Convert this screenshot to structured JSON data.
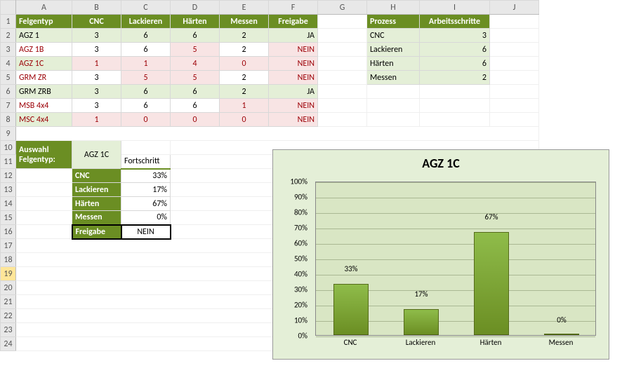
{
  "columns": [
    "A",
    "B",
    "C",
    "D",
    "E",
    "F",
    "G",
    "H",
    "I",
    "J"
  ],
  "tbl1_headers": [
    "Felgentyp",
    "CNC",
    "Lackieren",
    "Härten",
    "Messen",
    "Freigabe"
  ],
  "tbl1_rows": [
    {
      "name": "AGZ 1",
      "vals": [
        "3",
        "6",
        "6",
        "2",
        "JA"
      ],
      "style": "alt"
    },
    {
      "name": "AGZ 1B",
      "vals": [
        "3",
        "6",
        "5",
        "2",
        "NEIN"
      ],
      "style": "red",
      "redcols": [
        2
      ]
    },
    {
      "name": "AGZ 1C",
      "vals": [
        "1",
        "1",
        "4",
        "0",
        "NEIN"
      ],
      "style": "red",
      "redcols": [
        0,
        1,
        2,
        3
      ]
    },
    {
      "name": "GRM ZR",
      "vals": [
        "3",
        "5",
        "5",
        "2",
        "NEIN"
      ],
      "style": "red",
      "redcols": [
        1,
        2
      ]
    },
    {
      "name": "GRM ZRB",
      "vals": [
        "3",
        "6",
        "6",
        "2",
        "JA"
      ],
      "style": "alt"
    },
    {
      "name": "MSB 4x4",
      "vals": [
        "3",
        "6",
        "6",
        "1",
        "NEIN"
      ],
      "style": "red",
      "redcols": [
        3
      ]
    },
    {
      "name": "MSC 4x4",
      "vals": [
        "1",
        "0",
        "0",
        "0",
        "NEIN"
      ],
      "style": "red",
      "redcols": [
        0,
        1,
        2,
        3
      ]
    }
  ],
  "tbl2_headers": [
    "Prozess",
    "Arbeitsschritte"
  ],
  "tbl2_rows": [
    [
      "CNC",
      "3"
    ],
    [
      "Lackieren",
      "6"
    ],
    [
      "Härten",
      "6"
    ],
    [
      "Messen",
      "2"
    ]
  ],
  "auswahl_label": "Auswahl Felgentyp:",
  "auswahl_value": "AGZ 1C",
  "fortschritt_label": "Fortschritt",
  "progress_rows": [
    [
      "CNC",
      "33%"
    ],
    [
      "Lackieren",
      "17%"
    ],
    [
      "Härten",
      "67%"
    ],
    [
      "Messen",
      "0%"
    ]
  ],
  "freigabe_label": "Freigabe",
  "freigabe_value": "NEIN",
  "chart_data": {
    "type": "bar",
    "title": "AGZ 1C",
    "categories": [
      "CNC",
      "Lackieren",
      "Härten",
      "Messen"
    ],
    "values": [
      33,
      17,
      67,
      0
    ],
    "ylim": [
      0,
      100
    ],
    "ylabel": "",
    "xlabel": "",
    "y_ticks": [
      0,
      10,
      20,
      30,
      40,
      50,
      60,
      70,
      80,
      90,
      100
    ]
  }
}
